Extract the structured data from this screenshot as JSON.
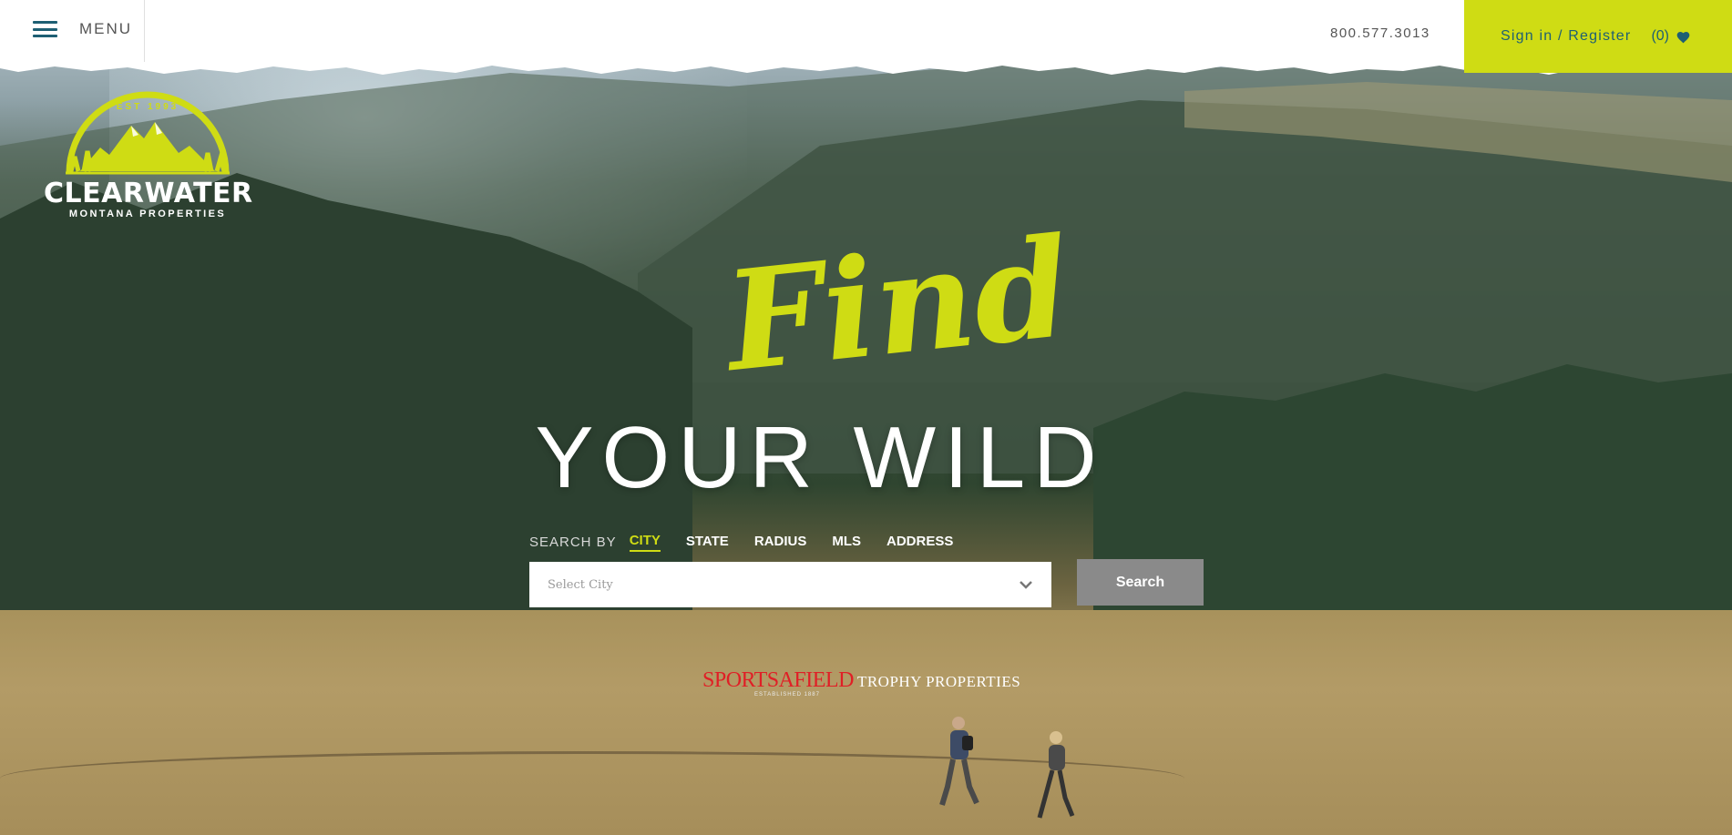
{
  "header": {
    "menu_label": "MENU",
    "phone": "800.577.3013",
    "signin_label": "Sign in / Register",
    "favorites_count": "(0)"
  },
  "logo": {
    "est": "EST 1993",
    "name": "CLEARWATER",
    "subtitle": "MONTANA PROPERTIES"
  },
  "hero": {
    "headline_script": "Find",
    "headline_main": "YOUR WILD"
  },
  "search": {
    "by_label": "SEARCH BY",
    "tabs": [
      {
        "label": "CITY",
        "active": true
      },
      {
        "label": "STATE",
        "active": false
      },
      {
        "label": "RADIUS",
        "active": false
      },
      {
        "label": "MLS",
        "active": false
      },
      {
        "label": "ADDRESS",
        "active": false
      }
    ],
    "city_placeholder": "Select City",
    "button_label": "Search"
  },
  "partner": {
    "brand": "SPORTSAFIELD",
    "tagline": "TROPHY PROPERTIES",
    "established": "ESTABLISHED 1887"
  },
  "colors": {
    "accent": "#cfdc14",
    "brand_teal": "#1e5f73",
    "search_button": "#8a8a8a",
    "partner_red": "#e01f26"
  }
}
